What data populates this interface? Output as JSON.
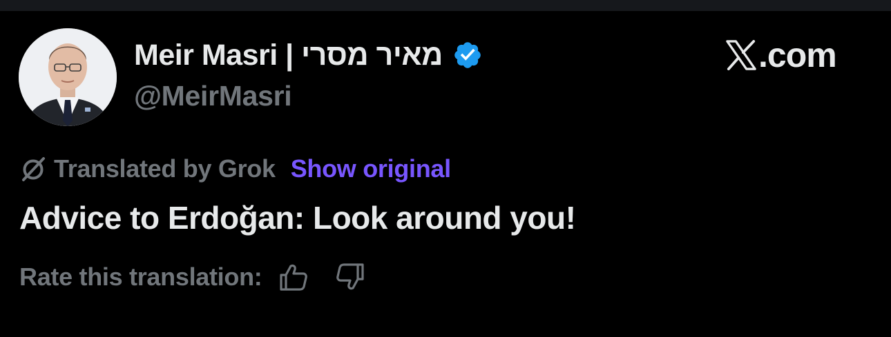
{
  "author": {
    "display_name": "Meir Masri | מאיר מסרי",
    "handle": "@MeirMasri",
    "verified": true,
    "verified_color": "#1d9bf0"
  },
  "brand": {
    "text": ".com",
    "icon": "x-logo-icon"
  },
  "translation": {
    "label": "Translated by Grok",
    "show_original": "Show original",
    "link_color": "#7856ff",
    "icon": "grok-icon"
  },
  "tweet": {
    "text": "Advice to Erdoğan: Look around you!"
  },
  "rating": {
    "label": "Rate this translation:",
    "up_icon": "thumbs-up-icon",
    "down_icon": "thumbs-down-icon"
  },
  "colors": {
    "background": "#000000",
    "primary_text": "#e7e9ea",
    "secondary_text": "#71767b"
  }
}
